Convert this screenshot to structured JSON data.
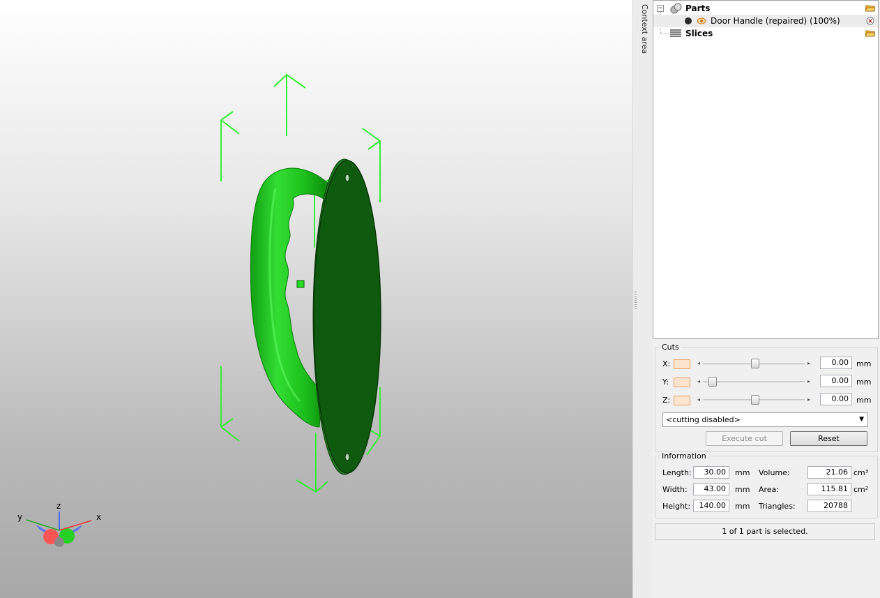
{
  "viewport": {
    "axis_labels": {
      "x": "x",
      "y": "y",
      "z": "z"
    },
    "model_color": "#22dd22",
    "dark_face_color": "#0a5a0a"
  },
  "context_tab": {
    "label": "Context area"
  },
  "tree": {
    "parts_label": "Parts",
    "part_item_label": "Door Handle (repaired) (100%)",
    "slices_label": "Slices"
  },
  "cuts": {
    "title": "Cuts",
    "x_label": "X:",
    "y_label": "Y:",
    "z_label": "Z:",
    "x_value": "0.00",
    "y_value": "0.00",
    "z_value": "0.00",
    "unit": "mm",
    "mode_selected": "<cutting disabled>",
    "execute_label": "Execute cut",
    "reset_label": "Reset"
  },
  "information": {
    "title": "Information",
    "length_label": "Length:",
    "length_value": "30.00",
    "width_label": "Width:",
    "width_value": "43.00",
    "height_label": "Height:",
    "height_value": "140.00",
    "mm_unit": "mm",
    "volume_label": "Volume:",
    "volume_value": "21.06",
    "volume_unit": "cm³",
    "area_label": "Area:",
    "area_value": "115.81",
    "area_unit": "cm²",
    "triangles_label": "Triangles:",
    "triangles_value": "20788"
  },
  "status": {
    "selection_text": "1 of 1 part is selected."
  }
}
